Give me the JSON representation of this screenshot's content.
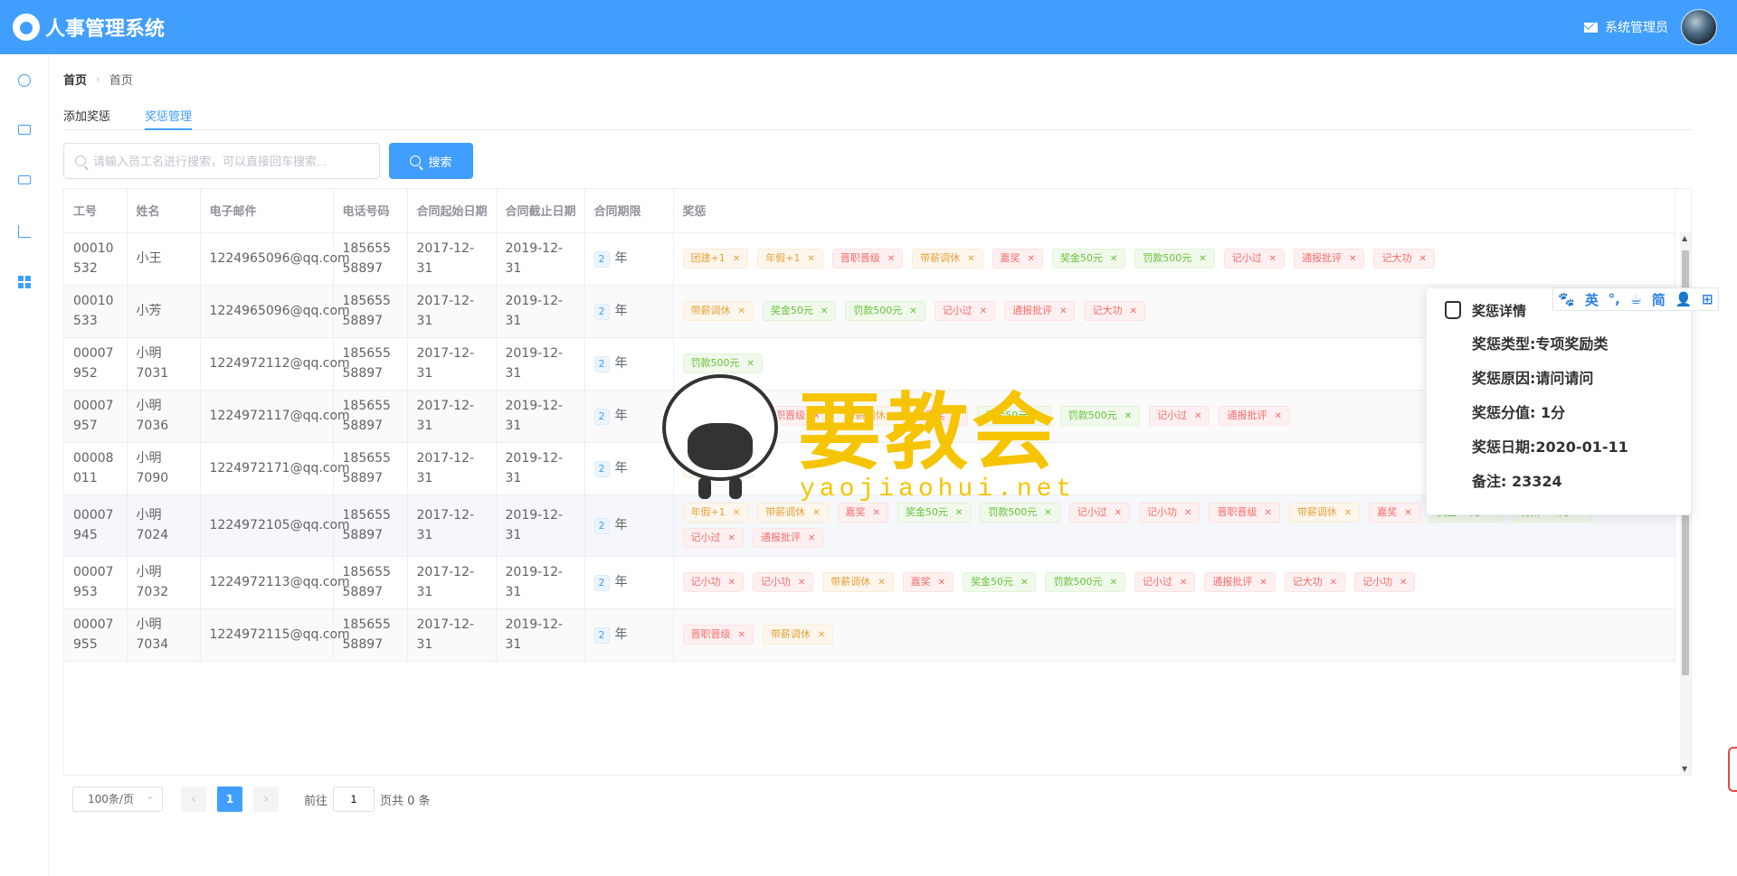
{
  "header": {
    "app_title": "人事管理系统",
    "user_label": "系统管理员"
  },
  "sidebar": {
    "icons": [
      "user-icon",
      "id-card-icon",
      "money-icon",
      "bar-chart-icon",
      "windows-icon"
    ]
  },
  "breadcrumb": {
    "home": "首页",
    "current": "首页"
  },
  "tabs": [
    {
      "label": "添加奖惩"
    },
    {
      "label": "奖惩管理"
    }
  ],
  "active_tab": 1,
  "search": {
    "placeholder": "请输入员工名进行搜索，可以直接回车搜索...",
    "button_label": "搜索"
  },
  "table": {
    "columns": [
      "工号",
      "姓名",
      "电子邮件",
      "电话号码",
      "合同起始日期",
      "合同截止日期",
      "合同期限",
      "奖惩"
    ],
    "year_unit": "年",
    "rows": [
      {
        "id": "00010532",
        "name": "小王",
        "email": "1224965096@qq.com",
        "phone": "18565558897",
        "start": "2017-12-31",
        "end": "2019-12-31",
        "years": "2",
        "tags": [
          [
            "团建+1",
            "warn"
          ],
          [
            "年假+1",
            "warn"
          ],
          [
            "晋职晋级",
            "danger"
          ],
          [
            "带薪调休",
            "warn"
          ],
          [
            "嘉奖",
            "danger"
          ],
          [
            "奖金50元",
            "success"
          ],
          [
            "罚款500元",
            "success"
          ],
          [
            "记小过",
            "danger"
          ],
          [
            "通报批评",
            "danger"
          ],
          [
            "记大功",
            "danger"
          ]
        ]
      },
      {
        "id": "00010533",
        "name": "小芳",
        "email": "1224965096@qq.com",
        "phone": "18565558897",
        "start": "2017-12-31",
        "end": "2019-12-31",
        "years": "2",
        "tags": [
          [
            "带薪调休",
            "warn"
          ],
          [
            "奖金50元",
            "success"
          ],
          [
            "罚款500元",
            "success"
          ],
          [
            "记小过",
            "danger"
          ],
          [
            "通报批评",
            "danger"
          ],
          [
            "记大功",
            "danger"
          ]
        ]
      },
      {
        "id": "00007952",
        "name": "小明7031",
        "email": "1224972112@qq.com",
        "phone": "18565558897",
        "start": "2017-12-31",
        "end": "2019-12-31",
        "years": "2",
        "tags": [
          [
            "罚款500元",
            "success"
          ]
        ]
      },
      {
        "id": "00007957",
        "name": "小明7036",
        "email": "1224972117@qq.com",
        "phone": "18565558897",
        "start": "2017-12-31",
        "end": "2019-12-31",
        "years": "2",
        "tags": [
          [
            "年假+1",
            "warn"
          ],
          [
            "晋职晋级",
            "danger"
          ],
          [
            "带薪调休",
            "warn"
          ],
          [
            "嘉奖",
            "danger"
          ],
          [
            "奖金50元",
            "success"
          ],
          [
            "罚款500元",
            "success"
          ],
          [
            "记小过",
            "danger"
          ],
          [
            "通报批评",
            "danger"
          ]
        ]
      },
      {
        "id": "00008011",
        "name": "小明7090",
        "email": "1224972171@qq.com",
        "phone": "18565558897",
        "start": "2017-12-31",
        "end": "2019-12-31",
        "years": "2",
        "tags": [
          [
            "带薪调休",
            "warn"
          ]
        ]
      },
      {
        "id": "00007945",
        "name": "小明7024",
        "email": "1224972105@qq.com",
        "phone": "18565558897",
        "start": "2017-12-31",
        "end": "2019-12-31",
        "years": "2",
        "tags": [
          [
            "年假+1",
            "warn"
          ],
          [
            "带薪调休",
            "warn"
          ],
          [
            "嘉奖",
            "danger"
          ],
          [
            "奖金50元",
            "success"
          ],
          [
            "罚款500元",
            "success"
          ],
          [
            "记小过",
            "danger"
          ],
          [
            "记小功",
            "danger"
          ],
          [
            "晋职晋级",
            "danger"
          ],
          [
            "带薪调休",
            "warn"
          ],
          [
            "嘉奖",
            "danger"
          ],
          [
            "奖金50元",
            "success"
          ],
          [
            "罚款500元",
            "success"
          ],
          [
            "记小过",
            "danger"
          ],
          [
            "通报批评",
            "danger"
          ]
        ]
      },
      {
        "id": "00007953",
        "name": "小明7032",
        "email": "1224972113@qq.com",
        "phone": "18565558897",
        "start": "2017-12-31",
        "end": "2019-12-31",
        "years": "2",
        "tags": [
          [
            "记小功",
            "danger"
          ],
          [
            "记小功",
            "danger"
          ],
          [
            "带薪调休",
            "warn"
          ],
          [
            "嘉奖",
            "danger"
          ],
          [
            "奖金50元",
            "success"
          ],
          [
            "罚款500元",
            "success"
          ],
          [
            "记小过",
            "danger"
          ],
          [
            "通报批评",
            "danger"
          ],
          [
            "记大功",
            "danger"
          ],
          [
            "记小功",
            "danger"
          ]
        ]
      },
      {
        "id": "00007955",
        "name": "小明7034",
        "email": "1224972115@qq.com",
        "phone": "18565558897",
        "start": "2017-12-31",
        "end": "2019-12-31",
        "years": "2",
        "tags": [
          [
            "晋职晋级",
            "danger"
          ],
          [
            "带薪调休",
            "warn"
          ]
        ]
      }
    ]
  },
  "pagination": {
    "page_size": "100条/页",
    "prev": "‹",
    "current": "1",
    "next": "›",
    "goto_label": "前往",
    "goto_value": "1",
    "total_label": "页共 0 条"
  },
  "popover": {
    "title": "奖惩详情",
    "type": "奖惩类型:专项奖励类",
    "reason": "奖惩原因:请问请问",
    "score": "奖惩分值: 1分",
    "date": "奖惩日期:2020-01-11",
    "note": "备注: 23324"
  },
  "ime_toolbar": {
    "items": [
      "🐾",
      "英",
      "°,",
      "☕",
      "简",
      "👤",
      "⊞"
    ]
  },
  "watermark": {
    "cn": "要教会",
    "en": "yaojiaohui.net"
  },
  "colors": {
    "primary": "#409eff",
    "warning": "#e6a23c",
    "danger": "#f56c6c",
    "success": "#67c23a",
    "watermark": "#f6c400"
  }
}
